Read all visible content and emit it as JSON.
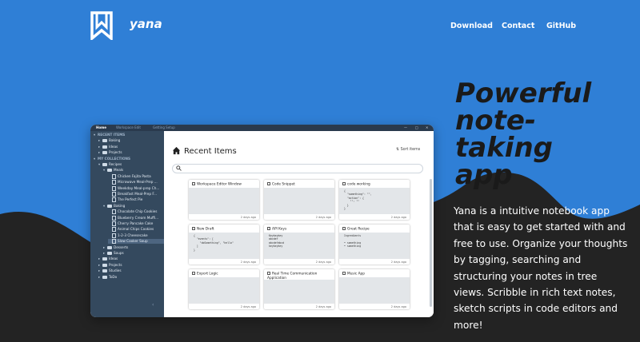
{
  "brand": {
    "name": "yana",
    "logo_icon": "bookmark-w-logo-icon"
  },
  "nav": {
    "download": "Download",
    "contact": "Contact",
    "github": "GitHub"
  },
  "hero": {
    "headline": [
      "Powerful",
      "note-",
      "taking",
      "app"
    ],
    "description": "Yana is a intuitive notebook app that is easy to get started with and free to use. Organize your thoughts by tagging, searching and structuring your notes in tree views. Scribble in rich text notes, sketch scripts in code editors and more!"
  },
  "colors": {
    "background": "#2f7fd6",
    "wave": "#232323",
    "sidebar": "#34495e"
  },
  "app": {
    "tabs": [
      "Home",
      "Workspace Edit",
      "Getting Setup"
    ],
    "main_title": "Recent Items",
    "sort_label": "Sort items",
    "search_placeholder": "",
    "sidebar": {
      "rows": [
        {
          "label": "RECENT ITEMS",
          "level": 0,
          "kind": "header"
        },
        {
          "label": "Baking",
          "level": 1,
          "kind": "folder"
        },
        {
          "label": "Ideas",
          "level": 1,
          "kind": "folder"
        },
        {
          "label": "Projects",
          "level": 1,
          "kind": "folder"
        },
        {
          "label": "MY COLLECTIONS",
          "level": 0,
          "kind": "header"
        },
        {
          "label": "Recipes",
          "level": 1,
          "kind": "folder"
        },
        {
          "label": "Meals",
          "level": 2,
          "kind": "folder"
        },
        {
          "label": "Chicken Fajita Pasta",
          "level": 3,
          "kind": "note"
        },
        {
          "label": "Microwave Meal-Prep ...",
          "level": 3,
          "kind": "note"
        },
        {
          "label": "Weekday Meal-prep Ch...",
          "level": 3,
          "kind": "note"
        },
        {
          "label": "Breakfast Meal-Prep F...",
          "level": 3,
          "kind": "note"
        },
        {
          "label": "The Perfect Pie",
          "level": 3,
          "kind": "note"
        },
        {
          "label": "Baking",
          "level": 2,
          "kind": "folder"
        },
        {
          "label": "Chocolate Chip Cookies",
          "level": 3,
          "kind": "note"
        },
        {
          "label": "Blueberry Cream Muffi...",
          "level": 3,
          "kind": "note"
        },
        {
          "label": "Cherry Pancake Cake",
          "level": 3,
          "kind": "note"
        },
        {
          "label": "Animal Chips Cookies",
          "level": 3,
          "kind": "note"
        },
        {
          "label": "1-2-3 Cheesecake",
          "level": 3,
          "kind": "note"
        },
        {
          "label": "Slow Cooker Soup",
          "level": 3,
          "kind": "note",
          "selected": true
        },
        {
          "label": "Desserts",
          "level": 2,
          "kind": "folder"
        },
        {
          "label": "Soups",
          "level": 2,
          "kind": "folder"
        },
        {
          "label": "Ideas",
          "level": 1,
          "kind": "folder"
        },
        {
          "label": "Projects",
          "level": 1,
          "kind": "folder"
        },
        {
          "label": "Studies",
          "level": 1,
          "kind": "folder"
        },
        {
          "label": "ToDo",
          "level": 1,
          "kind": "folder"
        }
      ]
    },
    "cards": [
      {
        "title": "Workspace Editor Window",
        "date": "2 days ago",
        "icon": "code-icon",
        "preview": ""
      },
      {
        "title": "Code Snippet",
        "date": "2 days ago",
        "icon": "code-icon",
        "preview": ""
      },
      {
        "title": "code working",
        "date": "2 days ago",
        "icon": "code-icon",
        "preview": "{\n  \"something\": \"\",\n  \"action\": {\n    \"\": \"\"\n  }\n}"
      },
      {
        "title": "New Draft",
        "date": "2 days ago",
        "icon": "code-icon",
        "preview": "{\n  \"events\": [\n    \"doSomething\", \"hello\"\n  ]\n}"
      },
      {
        "title": "API Keys",
        "date": "2 days ago",
        "icon": "code-icon",
        "preview": "Keykeykey\nabcdef\nabcdefabcd\nkeykeykey"
      },
      {
        "title": "Great Recipe",
        "date": "2 days ago",
        "icon": "text-icon",
        "preview": "Ingredients\n\n• something\n• something"
      },
      {
        "title": "Export Logic",
        "date": "2 days ago",
        "icon": "code-icon",
        "preview": ""
      },
      {
        "title": "Real Time Communication Application",
        "date": "2 days ago",
        "icon": "code-icon",
        "preview": ""
      },
      {
        "title": "Music App",
        "date": "2 days ago",
        "icon": "text-icon",
        "preview": ""
      }
    ]
  }
}
